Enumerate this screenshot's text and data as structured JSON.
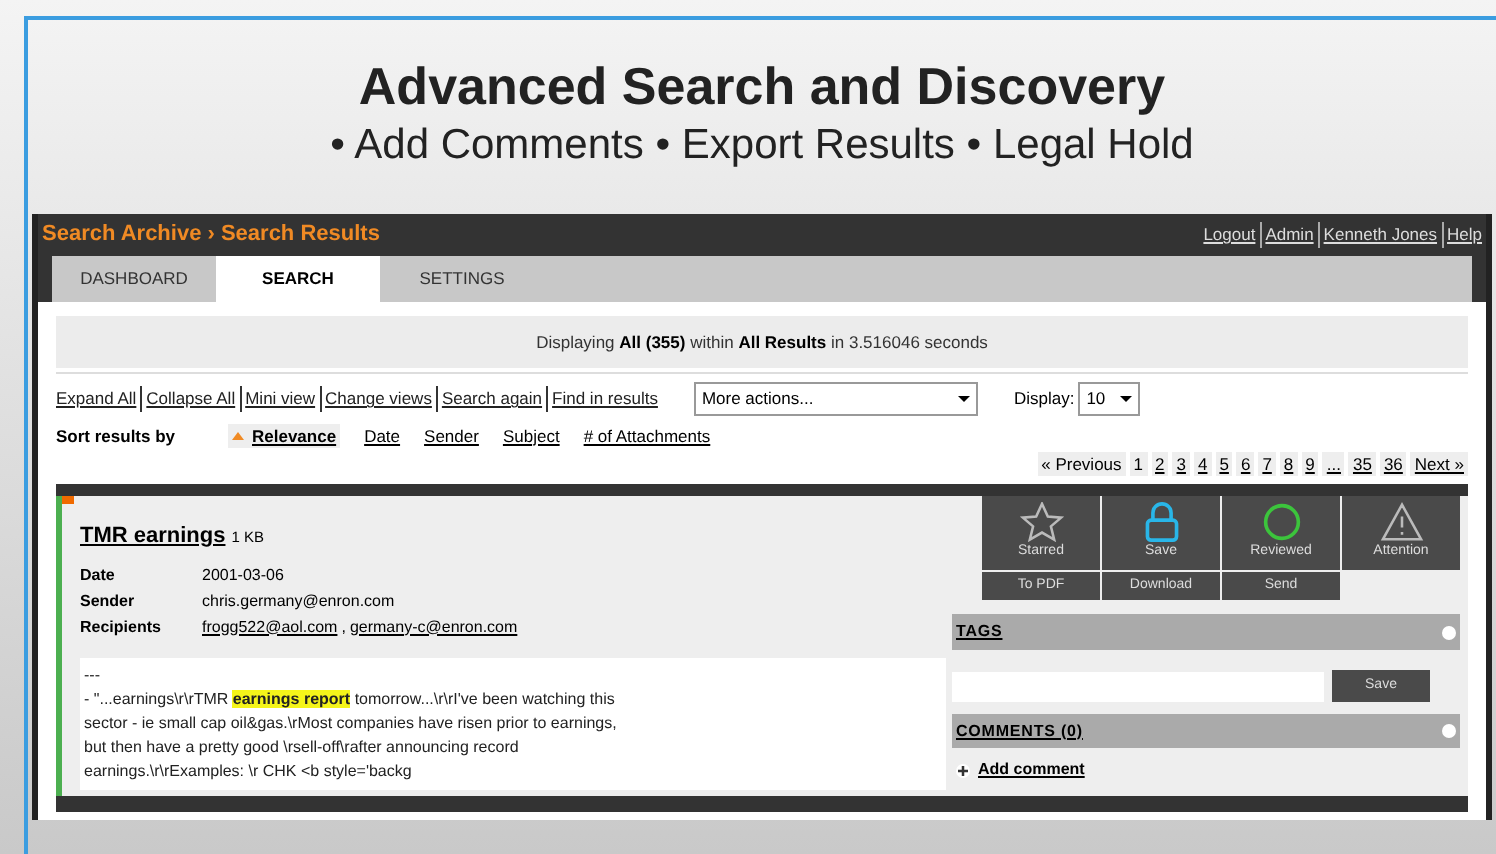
{
  "slide": {
    "title": "Advanced Search and Discovery",
    "subtitle": "• Add Comments • Export Results • Legal Hold"
  },
  "header": {
    "breadcrumb": "Search Archive › Search Results",
    "links": [
      "Logout",
      "Admin",
      "Kenneth Jones",
      "Help"
    ]
  },
  "tabs": [
    {
      "label": "DASHBOARD",
      "selected": false
    },
    {
      "label": "SEARCH",
      "selected": true
    },
    {
      "label": "SETTINGS",
      "selected": false
    }
  ],
  "summary": "Displaying **All (355)** within **All Results** in 3.516046 seconds",
  "toolbar": {
    "links": [
      "Expand All",
      "Collapse All",
      "Mini view",
      "Change views",
      "Search again",
      "Find in results"
    ],
    "actions_select": "More actions...",
    "display_label": "Display:",
    "display_select": "10"
  },
  "sort": {
    "label": "Sort results by",
    "options": [
      {
        "label": "Relevance",
        "selected": true
      },
      {
        "label": "Date",
        "selected": false
      },
      {
        "label": "Sender",
        "selected": false
      },
      {
        "label": "Subject",
        "selected": false
      },
      {
        "label": "# of Attachments",
        "selected": false
      }
    ]
  },
  "pagination": {
    "previous": "« Previous",
    "pages": [
      {
        "label": "1",
        "selected": true
      },
      {
        "label": "2",
        "selected": false
      },
      {
        "label": "3",
        "selected": false
      },
      {
        "label": "4",
        "selected": false
      },
      {
        "label": "5",
        "selected": false
      },
      {
        "label": "6",
        "selected": false
      },
      {
        "label": "7",
        "selected": false
      },
      {
        "label": "8",
        "selected": false
      },
      {
        "label": "9",
        "selected": false
      },
      {
        "label": "...",
        "selected": false
      },
      {
        "label": "35",
        "selected": false
      },
      {
        "label": "36",
        "selected": false
      }
    ],
    "next": "Next »"
  },
  "result": {
    "title": "TMR earnings",
    "size": "1 KB",
    "fields": [
      {
        "label": "Date",
        "value": "2001-03-06",
        "kind": "text"
      },
      {
        "label": "Sender",
        "value": "chris.germany@enron.com",
        "kind": "text"
      },
      {
        "label": "Recipients",
        "values": [
          "frogg522@aol.com",
          "germany-c@enron.com"
        ],
        "separator": ",",
        "kind": "links"
      }
    ],
    "snippet_dash": "---",
    "snippet": "- \"...earnings\\r\\rTMR **earnings report** tomorrow...\\r\\rI've been watching this sector - ie small cap oil&gas.\\rMost companies have risen prior to earnings, but then have a pretty good \\rsell-off\\rafter announcing record earnings.\\r\\rExamples: \\r CHK <b style='backg",
    "actions": [
      {
        "label": "Starred",
        "kind": "star"
      },
      {
        "label": "Save",
        "kind": "lock"
      },
      {
        "label": "Reviewed",
        "kind": "circle"
      },
      {
        "label": "Attention",
        "kind": "warning"
      }
    ],
    "exports": [
      "To PDF",
      "Download",
      "Send"
    ],
    "tags_heading": "TAGS",
    "tag_save": "Save",
    "comments_heading": "COMMENTS (0)",
    "add_comment": "Add comment"
  }
}
